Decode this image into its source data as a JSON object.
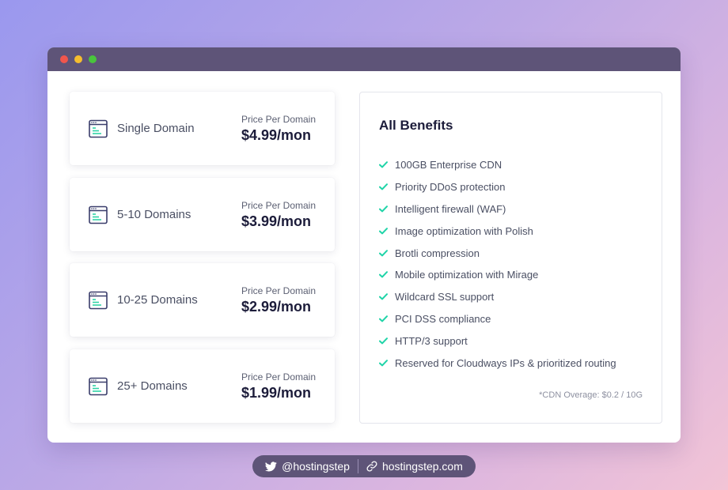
{
  "window": {
    "controls": [
      "close",
      "minimize",
      "maximize"
    ]
  },
  "plans": [
    {
      "name": "Single Domain",
      "price_label": "Price Per Domain",
      "price": "$4.99/mon",
      "icon": "browser-window-icon"
    },
    {
      "name": "5-10 Domains",
      "price_label": "Price Per Domain",
      "price": "$3.99/mon",
      "icon": "browser-window-icon"
    },
    {
      "name": "10-25 Domains",
      "price_label": "Price Per Domain",
      "price": "$2.99/mon",
      "icon": "browser-window-icon"
    },
    {
      "name": "25+ Domains",
      "price_label": "Price Per Domain",
      "price": "$1.99/mon",
      "icon": "browser-window-icon"
    }
  ],
  "benefits": {
    "title": "All Benefits",
    "items": [
      "100GB Enterprise CDN",
      "Priority DDoS protection",
      "Intelligent firewall (WAF)",
      "Image optimization with Polish",
      "Brotli compression",
      "Mobile optimization with Mirage",
      "Wildcard SSL support",
      "PCI DSS compliance",
      "HTTP/3 support",
      "Reserved for Cloudways IPs & prioritized routing"
    ],
    "note": "*CDN Overage: $0.2 / 10G"
  },
  "footer": {
    "twitter_handle": "@hostingstep",
    "website": "hostingstep.com"
  },
  "colors": {
    "titlebar": "#5e5478",
    "check": "#1fd4a8",
    "icon_stroke": "#3a3d6b",
    "icon_accent": "#2fd3a6",
    "heading": "#1c1c3a"
  }
}
